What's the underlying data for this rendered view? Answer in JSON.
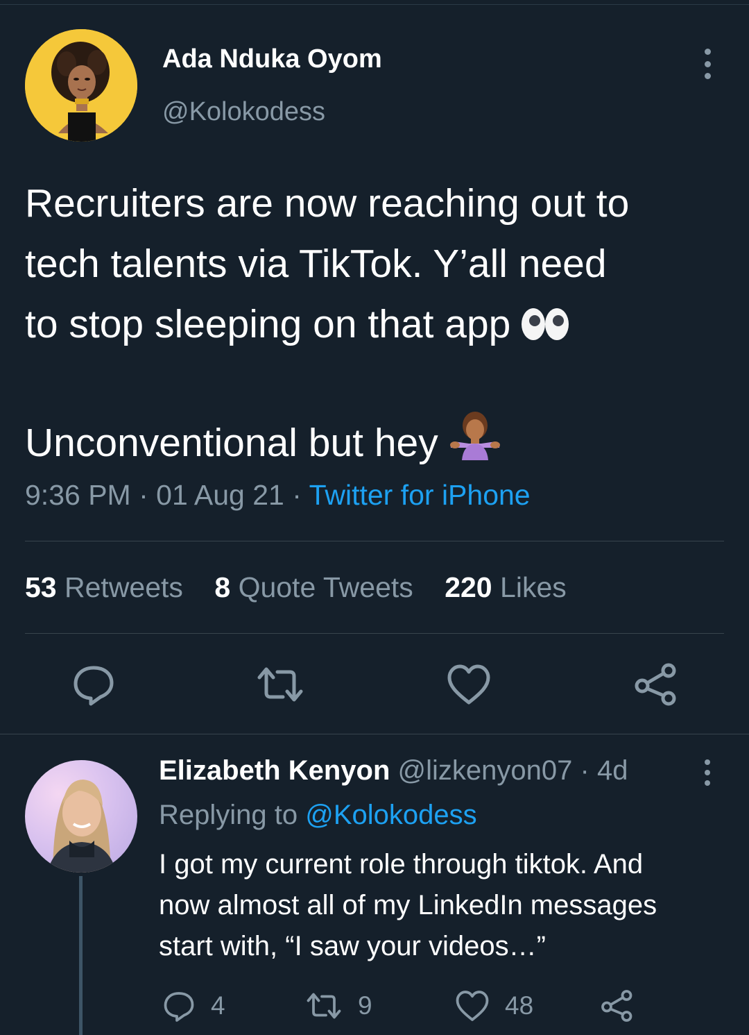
{
  "tweet": {
    "author": {
      "name": "Ada Nduka Oyom",
      "handle": "@Kolokodess",
      "avatar": "cartoon-avatar-woman-yellow-bg"
    },
    "text_lines": [
      "Recruiters are now reaching out to",
      "tech talents via TikTok. Y’all need",
      "to stop sleeping on that app"
    ],
    "text_line_2": "Unconventional but hey",
    "emojis": [
      "eyes-emoji",
      "person-shrugging-emoji"
    ],
    "time": "9:36 PM",
    "date": "01 Aug 21",
    "source": "Twitter for iPhone",
    "separator": "·",
    "stats": {
      "retweets_count": "53",
      "retweets_label": "Retweets",
      "quotes_count": "8",
      "quotes_label": "Quote Tweets",
      "likes_count": "220",
      "likes_label": "Likes"
    },
    "actions": [
      "reply-icon",
      "retweet-icon",
      "like-icon",
      "share-icon"
    ]
  },
  "reply": {
    "name": "Elizabeth Kenyon",
    "handle": "@lizkenyon07",
    "age": "4d",
    "replying_prefix": "Replying to",
    "replying_handle": "@Kolokodess",
    "text_lines": [
      "I got my current role through tiktok. And",
      "now almost all of my LinkedIn messages",
      "start with, “I saw your videos…”"
    ],
    "reply_count": "4",
    "retweet_count": "9",
    "like_count": "48"
  },
  "colors": {
    "background": "#15202b",
    "secondary_text": "#8899a6",
    "link": "#1da1f2",
    "divider": "#38444d"
  }
}
